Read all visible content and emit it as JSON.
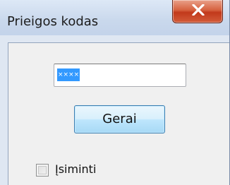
{
  "window": {
    "title": "Prieigos kodas"
  },
  "form": {
    "code_value": "××××",
    "ok_label": "Gerai",
    "remember_label": "Įsiminti",
    "remember_checked": false
  },
  "icons": {
    "close": "close-icon"
  },
  "colors": {
    "selection": "#3399ff",
    "close_button": "#c2391b",
    "ok_button": "#bee6fd"
  }
}
